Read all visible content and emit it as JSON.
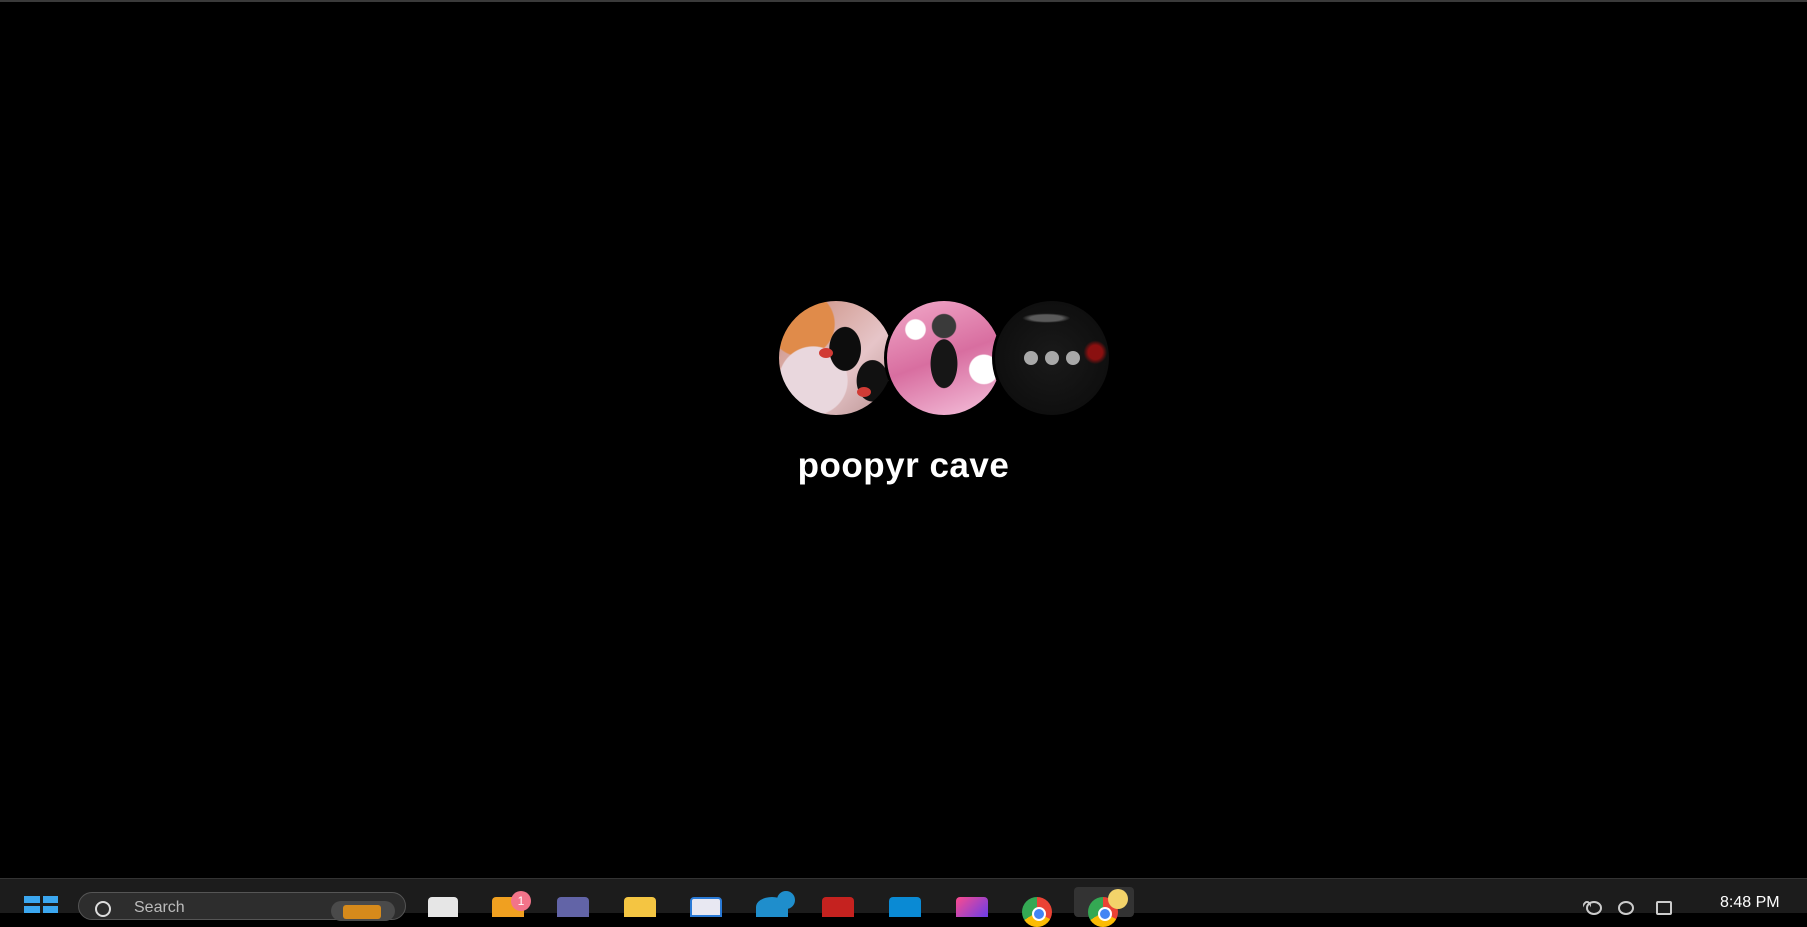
{
  "group": {
    "name": "poopyr cave",
    "avatars": [
      "member-avatar-1",
      "member-avatar-2",
      "more-members"
    ]
  },
  "taskbar": {
    "search_placeholder": "Search",
    "mail_badge_count": "1",
    "clock_time": "8:48 PM",
    "icons": [
      "start",
      "search",
      "task-view",
      "mail",
      "teams",
      "file-explorer",
      "store",
      "edge",
      "gmail",
      "azure",
      "intellij",
      "chrome",
      "chrome-profile"
    ]
  },
  "colors": {
    "background": "#000000",
    "taskbar": "#1c1c1c",
    "accent": "#3ba7f0"
  }
}
